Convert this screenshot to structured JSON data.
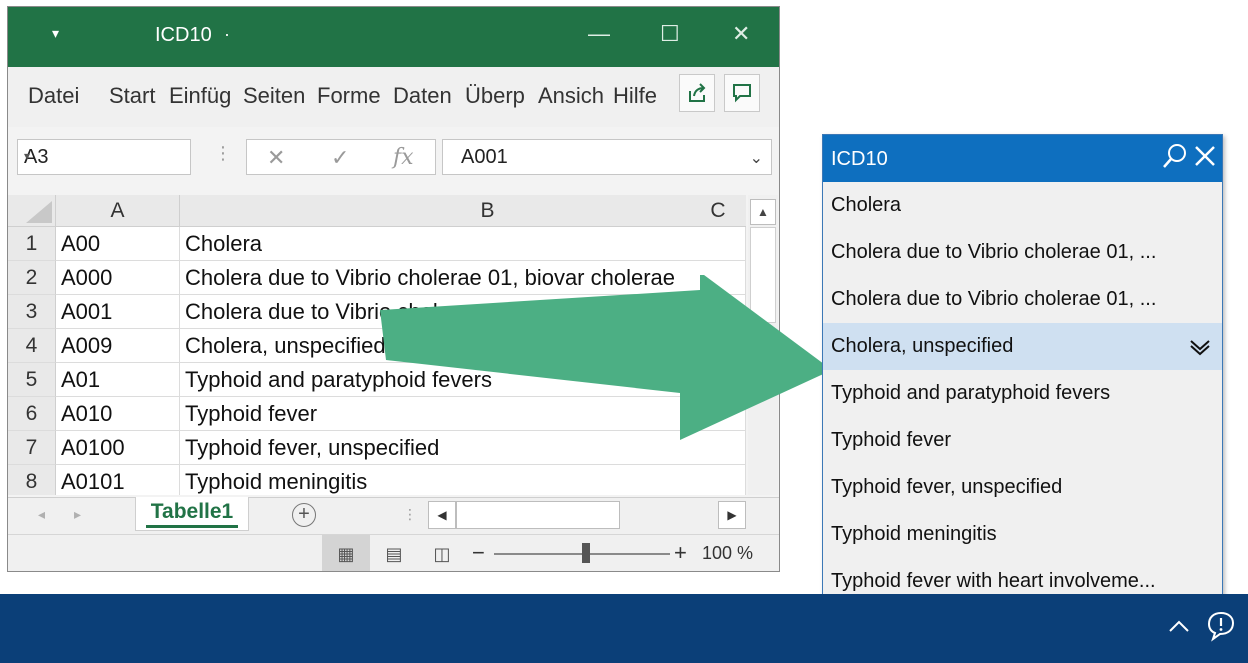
{
  "excel": {
    "title": "ICD10",
    "title_dot": "·",
    "quick_access": "▾",
    "ribbon_tabs": [
      "Datei",
      "Start",
      "Einfüg",
      "Seiten",
      "Forme",
      "Daten",
      "Überp",
      "Ansich",
      "Hilfe"
    ],
    "name_box": "A3",
    "formula_value": "A001",
    "fx_cancel": "✕",
    "fx_enter": "✓",
    "fx_label": "fx",
    "columns": [
      "A",
      "B",
      "C"
    ],
    "rows": [
      {
        "num": "1",
        "a": "A00",
        "b": "Cholera"
      },
      {
        "num": "2",
        "a": "A000",
        "b": "Cholera due to Vibrio cholerae 01, biovar cholerae"
      },
      {
        "num": "3",
        "a": "A001",
        "b": "Cholera due to Vibrio cholerae 01, biovar eltor"
      },
      {
        "num": "4",
        "a": "A009",
        "b": "Cholera, unspecified"
      },
      {
        "num": "5",
        "a": "A01",
        "b": "Typhoid and paratyphoid fevers"
      },
      {
        "num": "6",
        "a": "A010",
        "b": "Typhoid fever"
      },
      {
        "num": "7",
        "a": "A0100",
        "b": "Typhoid fever, unspecified"
      },
      {
        "num": "8",
        "a": "A0101",
        "b": "Typhoid meningitis"
      }
    ],
    "sheet_tab": "Tabelle1",
    "add_sheet": "+",
    "zoom_minus": "−",
    "zoom_plus": "+",
    "zoom": "100 %",
    "zoom_fraction": 0.5
  },
  "panel": {
    "title": "ICD10",
    "items": [
      "Cholera",
      "Cholera due to Vibrio cholerae 01, ...",
      "Cholera due to Vibrio cholerae 01, ...",
      "Cholera, unspecified",
      "Typhoid and paratyphoid fevers",
      "Typhoid fever",
      "Typhoid fever, unspecified",
      "Typhoid meningitis",
      "Typhoid fever with heart involveme..."
    ],
    "selected_index": 3
  },
  "colors": {
    "excel_green": "#217346",
    "panel_blue": "#0e6fbf",
    "arrow_green": "#4caf84",
    "taskbar": "#0b3f78",
    "selection": "#cfe0f1"
  }
}
